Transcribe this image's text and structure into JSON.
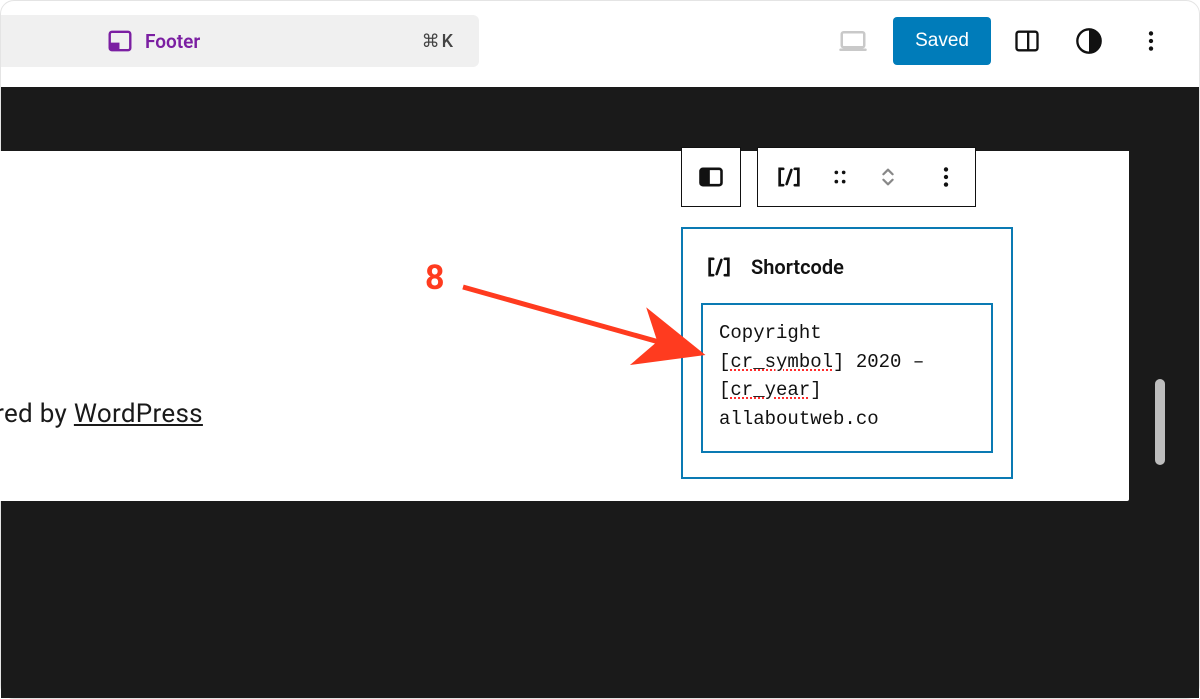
{
  "header": {
    "template_name": "Footer",
    "shortcut": "⌘K",
    "saved_label": "Saved"
  },
  "canvas": {
    "powered_prefix": "ered by ",
    "powered_link": "WordPress"
  },
  "block": {
    "title": "Shortcode",
    "text_lines": [
      "Copyright",
      "[cr_symbol] 2020 –",
      "[cr_year]",
      "allaboutweb.co"
    ],
    "spell_tokens": [
      "cr_symbol",
      "cr_year"
    ]
  },
  "annotation": {
    "number": "8"
  },
  "colors": {
    "accent_purple": "#7b1fa2",
    "wp_blue": "#007cba",
    "selection_blue": "#0a7ab3",
    "anno_red": "#ff3b1f"
  }
}
